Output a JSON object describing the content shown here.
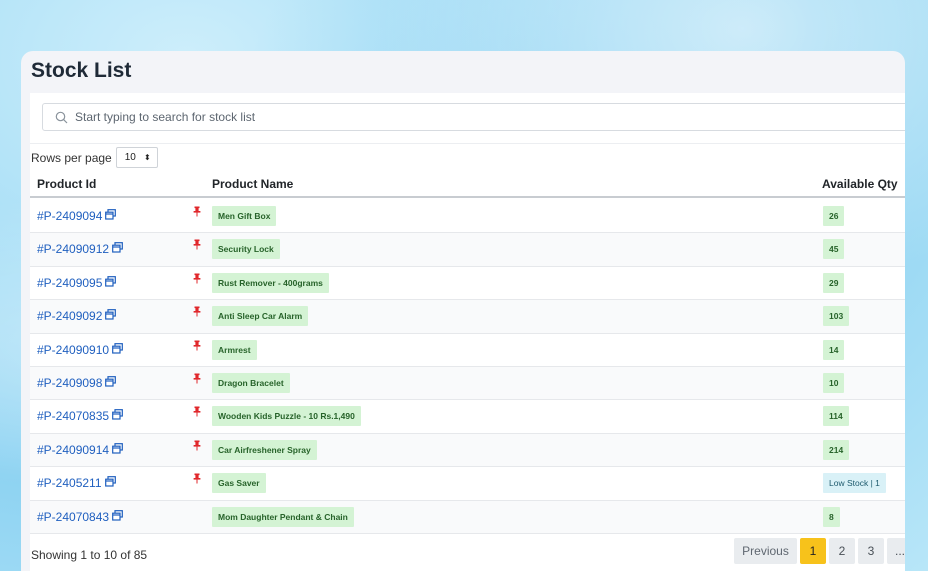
{
  "page": {
    "title": "Stock List"
  },
  "search": {
    "placeholder": "Start typing to search for stock list"
  },
  "rows_per_page": {
    "label": "Rows per page",
    "value": "10"
  },
  "columns": {
    "product_id": "Product Id",
    "product_name": "Product Name",
    "available_qty": "Available Qty"
  },
  "rows": [
    {
      "id": "#P-2409094",
      "pinned": true,
      "name": "Men Gift Box",
      "qty": "26",
      "status": "ok"
    },
    {
      "id": "#P-24090912",
      "pinned": true,
      "name": "Security Lock",
      "qty": "45",
      "status": "ok"
    },
    {
      "id": "#P-2409095",
      "pinned": true,
      "name": "Rust Remover - 400grams",
      "qty": "29",
      "status": "ok"
    },
    {
      "id": "#P-2409092",
      "pinned": true,
      "name": "Anti Sleep Car Alarm",
      "qty": "103",
      "status": "ok"
    },
    {
      "id": "#P-24090910",
      "pinned": true,
      "name": "Armrest",
      "qty": "14",
      "status": "ok"
    },
    {
      "id": "#P-2409098",
      "pinned": true,
      "name": "Dragon Bracelet",
      "qty": "10",
      "status": "ok"
    },
    {
      "id": "#P-24070835",
      "pinned": true,
      "name": "Wooden Kids Puzzle - 10 Rs.1,490",
      "qty": "114",
      "status": "ok"
    },
    {
      "id": "#P-24090914",
      "pinned": true,
      "name": "Car Airfreshener Spray",
      "qty": "214",
      "status": "ok"
    },
    {
      "id": "#P-2405211",
      "pinned": true,
      "name": "Gas Saver",
      "qty": "Low Stock | 1",
      "status": "low"
    },
    {
      "id": "#P-24070843",
      "pinned": false,
      "name": "Mom Daughter Pendant & Chain",
      "qty": "8",
      "status": "ok"
    }
  ],
  "footer": {
    "showing": "Showing 1 to 10 of 85",
    "pagination": {
      "previous": "Previous",
      "pages": [
        "1",
        "2",
        "3"
      ],
      "more": "...",
      "active": "1"
    }
  },
  "colors": {
    "accent": "#f7c21b",
    "link": "#1f5fbf",
    "badge_green": "#d4f3d4",
    "badge_low": "#d9f1f7",
    "pin": "#e0272b"
  }
}
